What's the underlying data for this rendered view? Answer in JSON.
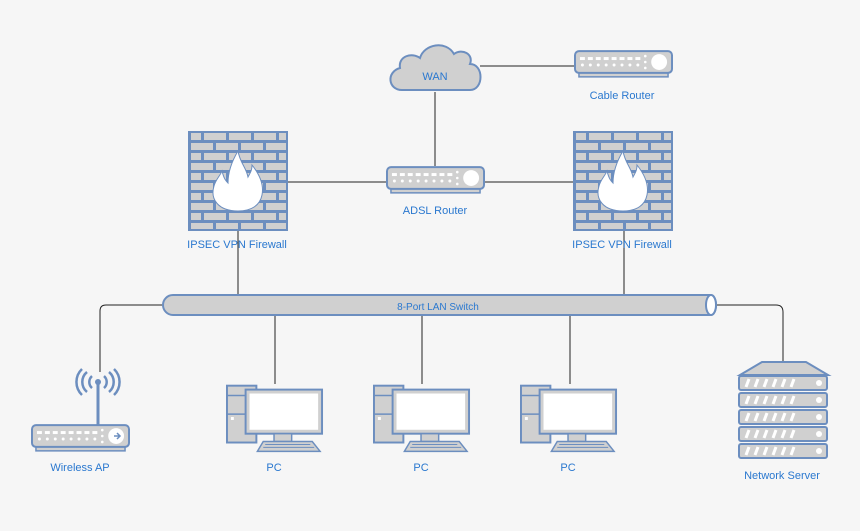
{
  "nodes": {
    "wan": {
      "label": "WAN",
      "icon": "cloud-icon"
    },
    "cable_router": {
      "label": "Cable Router",
      "icon": "router-icon"
    },
    "adsl_router": {
      "label": "ADSL Router",
      "icon": "router-icon"
    },
    "firewall_left": {
      "label": "IPSEC VPN Firewall",
      "icon": "firewall-icon"
    },
    "firewall_right": {
      "label": "IPSEC VPN Firewall",
      "icon": "firewall-icon"
    },
    "switch": {
      "label": "8-Port LAN Switch",
      "icon": "bus-switch-icon"
    },
    "wireless_ap": {
      "label": "Wireless AP",
      "icon": "wireless-ap-icon"
    },
    "pcs": [
      {
        "label": "PC",
        "icon": "pc-icon"
      },
      {
        "label": "PC",
        "icon": "pc-icon"
      },
      {
        "label": "PC",
        "icon": "pc-icon"
      }
    ],
    "server": {
      "label": "Network Server",
      "icon": "server-icon"
    }
  },
  "colors": {
    "outline": "#6c8ebf",
    "fill": "#d0d0d0",
    "label": "#2a78cf",
    "background": "#f6f6f6"
  }
}
